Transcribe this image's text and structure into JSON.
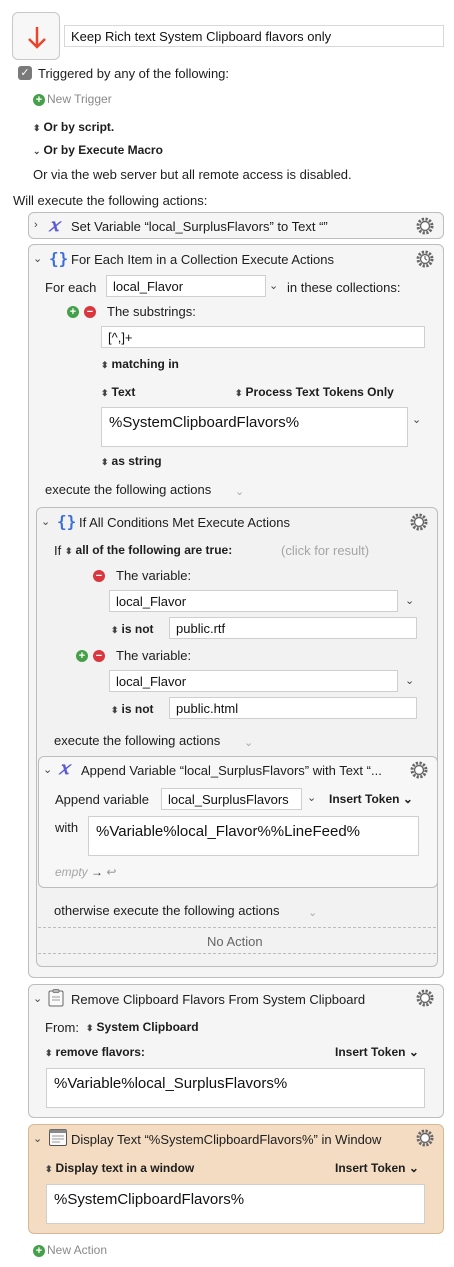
{
  "macro": {
    "name": "Keep Rich text System Clipboard flavors only",
    "triggered_label": "Triggered by any of the following:",
    "new_trigger": "New Trigger",
    "or_by_script": "Or by script.",
    "or_by_execute_macro": "Or by Execute Macro",
    "web_server_note": "Or via the web server but all remote access is disabled.",
    "will_execute": "Will execute the following actions:",
    "new_action": "New Action"
  },
  "action1": {
    "title": "Set Variable “local_SurplusFlavors” to Text “”"
  },
  "action2": {
    "title": "For Each Item in a Collection Execute Actions",
    "for_each": "For each",
    "variable": "local_Flavor",
    "in_collections": "in these collections:",
    "substrings_label": "The substrings:",
    "substrings_value": "[^,]+",
    "matching_in": "matching in",
    "text_label": "Text",
    "process_tokens": "Process Text Tokens Only",
    "text_value": "%SystemClipboardFlavors%",
    "as_string": "as string",
    "execute_following": "execute the following actions"
  },
  "action3": {
    "title": "If All Conditions Met Execute Actions",
    "if_label": "If",
    "all_true": "all of the following are true:",
    "click_result": "(click for result)",
    "cond1_label": "The variable:",
    "cond1_var": "local_Flavor",
    "cond1_op": "is not",
    "cond1_value": "public.rtf",
    "cond2_label": "The variable:",
    "cond2_var": "local_Flavor",
    "cond2_op": "is not",
    "cond2_value": "public.html",
    "execute_following": "execute the following actions",
    "otherwise": "otherwise execute the following actions",
    "no_action": "No Action"
  },
  "action4": {
    "title": "Append Variable “local_SurplusFlavors” with Text “...",
    "append_label": "Append variable",
    "append_var": "local_SurplusFlavors",
    "insert_token": "Insert Token",
    "with_label": "with",
    "with_value": "%Variable%local_Flavor%%LineFeed%",
    "empty": "empty"
  },
  "action5": {
    "title": "Remove Clipboard Flavors From System Clipboard",
    "from_label": "From:",
    "from_value": "System Clipboard",
    "remove_label": "remove flavors:",
    "insert_token": "Insert Token",
    "value": "%Variable%local_SurplusFlavors%"
  },
  "action6": {
    "title": "Display Text “%SystemClipboardFlavors%” in Window",
    "mode": "Display text in a window",
    "insert_token": "Insert Token",
    "value": "%SystemClipboardFlavors%"
  },
  "colors": {
    "display_bg": "#f3dcc2",
    "accent_red": "#e8452c",
    "var_icon": "#5b5bd6",
    "brace_icon": "#3b6fd8"
  },
  "icons": [
    "down-arrow-icon",
    "checkbox-icon",
    "plus-circle-icon",
    "minus-circle-icon",
    "gear-icon",
    "variable-icon",
    "brace-icon",
    "clipboard-icon",
    "window-icon"
  ]
}
